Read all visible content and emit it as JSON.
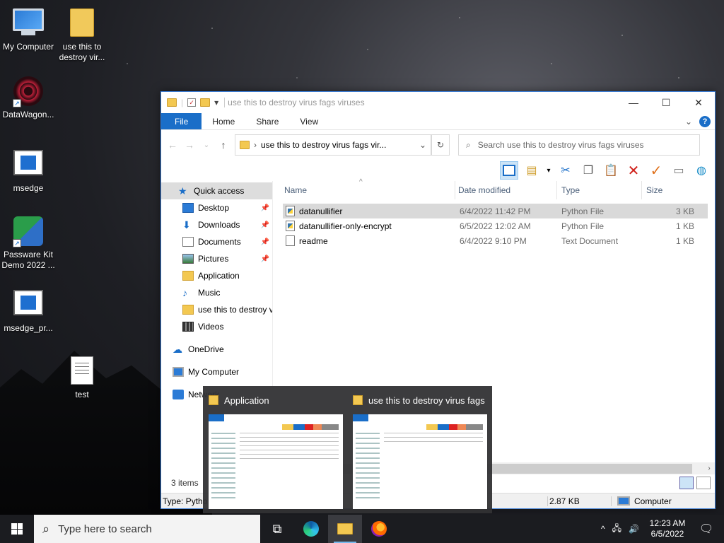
{
  "desktop": {
    "icons": [
      {
        "label": "My Computer",
        "icon": "computer-icon"
      },
      {
        "label": "use this to destroy vir...",
        "icon": "folder-icon"
      },
      {
        "label": "DataWagon...",
        "icon": "datawagon-icon"
      },
      {
        "label": "msedge",
        "icon": "app-window-icon"
      },
      {
        "label": "Passware Kit Demo 2022 ...",
        "icon": "passware-icon"
      },
      {
        "label": "msedge_pr...",
        "icon": "app-window-icon"
      },
      {
        "label": "test",
        "icon": "text-file-icon"
      }
    ]
  },
  "explorer": {
    "title": "use this to destroy virus fags viruses",
    "tabs": [
      "File",
      "Home",
      "Share",
      "View"
    ],
    "address": "use this to destroy virus fags vir...",
    "search_placeholder": "Search use this to destroy virus fags viruses",
    "nav": {
      "quick_access": "Quick access",
      "items": [
        {
          "label": "Desktop",
          "pinned": true
        },
        {
          "label": "Downloads",
          "pinned": true
        },
        {
          "label": "Documents",
          "pinned": true
        },
        {
          "label": "Pictures",
          "pinned": true
        },
        {
          "label": "Application",
          "pinned": false
        },
        {
          "label": "Music",
          "pinned": false
        },
        {
          "label": "use this to destroy v",
          "pinned": false
        },
        {
          "label": "Videos",
          "pinned": false
        }
      ],
      "onedrive": "OneDrive",
      "my_computer": "My Computer",
      "network": "Network"
    },
    "columns": {
      "name": "Name",
      "date": "Date modified",
      "type": "Type",
      "size": "Size"
    },
    "files": [
      {
        "name": "datanullifier",
        "date": "6/4/2022 11:42 PM",
        "type": "Python File",
        "size": "3 KB",
        "selected": true
      },
      {
        "name": "datanullifier-only-encrypt",
        "date": "6/5/2022 12:02 AM",
        "type": "Python File",
        "size": "1 KB",
        "selected": false
      },
      {
        "name": "readme",
        "date": "6/4/2022 9:10 PM",
        "type": "Text Document",
        "size": "1 KB",
        "selected": false
      }
    ],
    "status": {
      "items": "3 items"
    },
    "details": {
      "type": "Type: Pytho",
      "size": "2.87 KB",
      "location": "Computer"
    }
  },
  "thumbnails": [
    {
      "title": "Application"
    },
    {
      "title": "use this to destroy virus fags ..."
    }
  ],
  "taskbar": {
    "search_placeholder": "Type here to search",
    "time": "12:23 AM",
    "date": "6/5/2022"
  }
}
